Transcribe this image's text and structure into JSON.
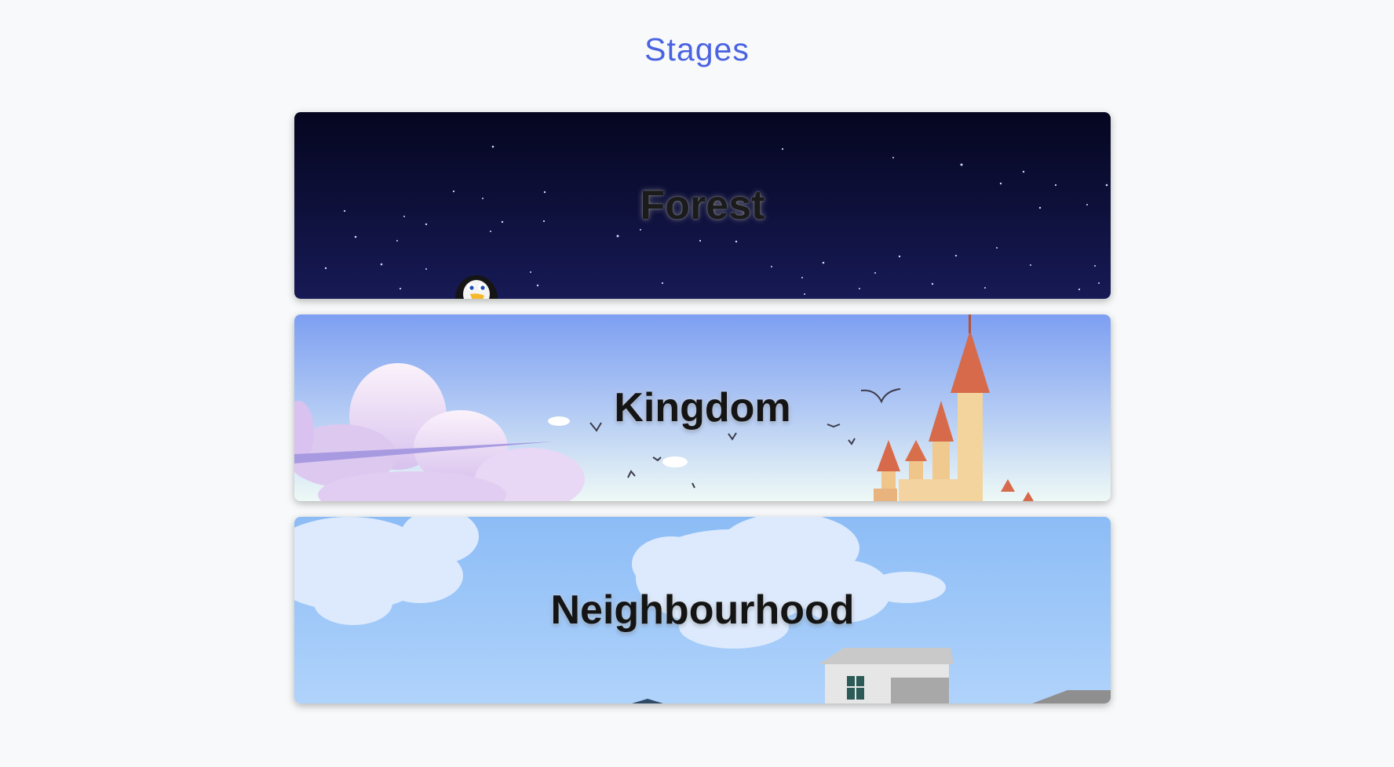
{
  "page": {
    "title": "Stages"
  },
  "stages": [
    {
      "label": "Forest",
      "theme": "night-sky",
      "colors": {
        "top": "#050620",
        "bottom": "#171a55"
      }
    },
    {
      "label": "Kingdom",
      "theme": "castle-day",
      "colors": {
        "top": "#7d9ff2",
        "bottom": "#e9f6f8"
      }
    },
    {
      "label": "Neighbourhood",
      "theme": "cloudy-sky",
      "colors": {
        "top": "#8cbcf6",
        "bottom": "#b0d3fb"
      }
    }
  ],
  "accent_color": "#4a63e0"
}
